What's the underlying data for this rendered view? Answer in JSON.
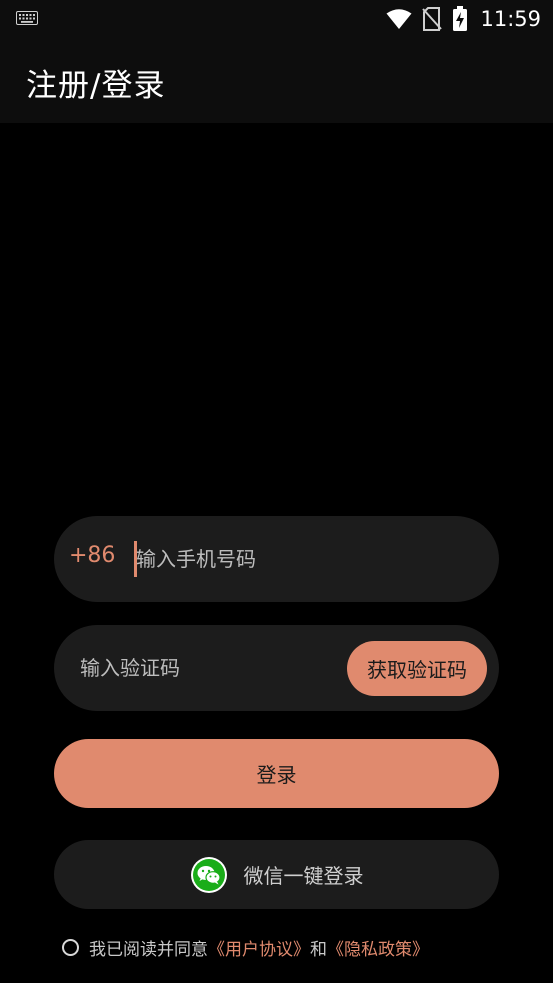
{
  "status_bar": {
    "time": "11:59",
    "icons": [
      "keyboard-icon",
      "wifi-icon",
      "no-sim-icon",
      "battery-charging-icon"
    ]
  },
  "app_bar": {
    "title": "注册/登录"
  },
  "login_form": {
    "country_code": "+86",
    "phone_placeholder": "输入手机号码",
    "code_placeholder": "输入验证码",
    "get_code_label": "获取验证码",
    "login_label": "登录",
    "wechat_label": "微信一键登录"
  },
  "agreement": {
    "prefix": "我已阅读并同意",
    "user_agreement": "《用户协议》",
    "conjunction": "和",
    "privacy_policy": "《隐私政策》"
  },
  "colors": {
    "accent": "#e08a6e",
    "background": "#000000",
    "field_background": "#1c1c1c",
    "wechat_green": "#1aad19"
  }
}
